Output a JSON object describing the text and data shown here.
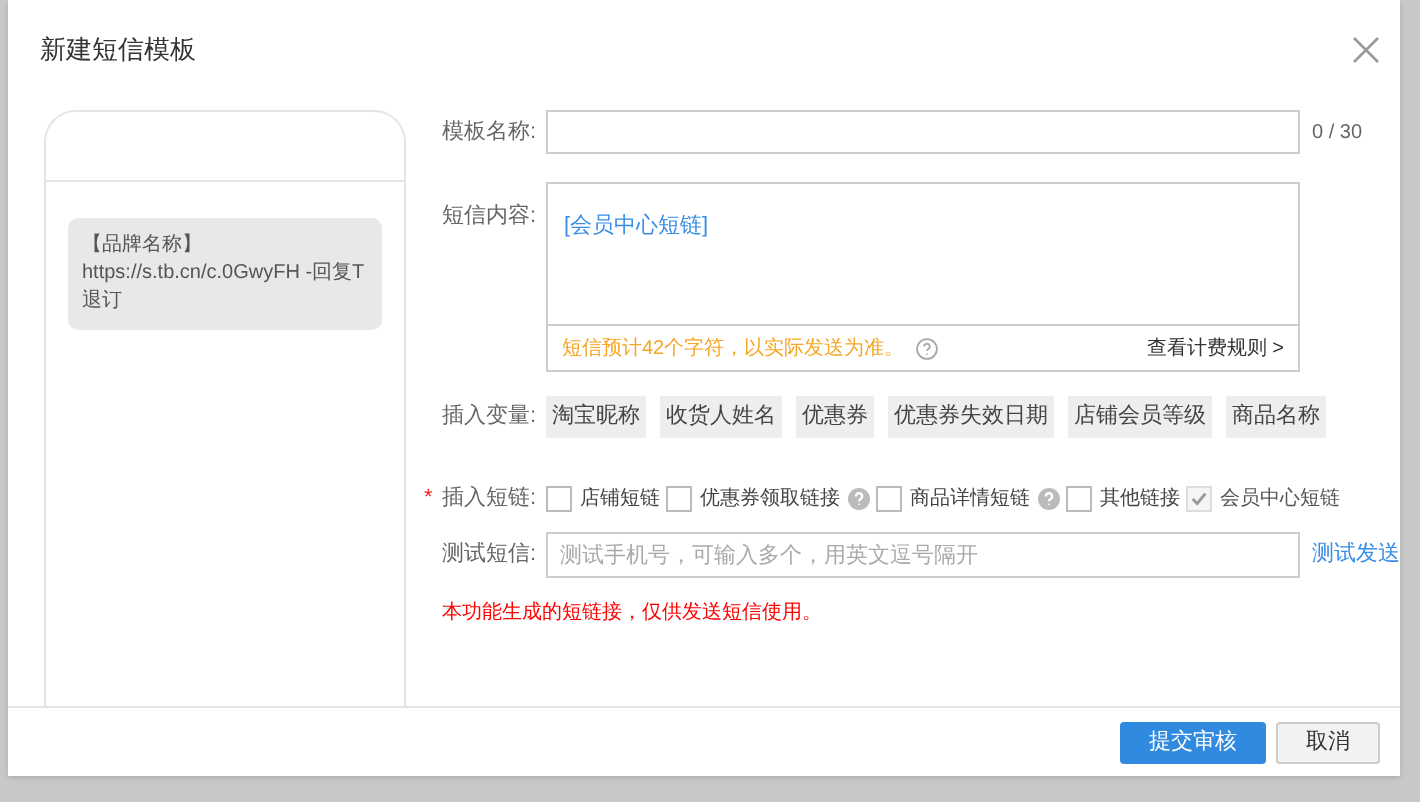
{
  "dialog": {
    "title": "新建短信模板"
  },
  "preview": {
    "lines": [
      "【品牌名称】",
      "https://s.tb.cn/c.0GwyFH -回复T",
      "退订"
    ]
  },
  "template_name": {
    "label": "模板名称:",
    "counter": "0 / 30"
  },
  "content": {
    "label": "短信内容:",
    "value": "[会员中心短链]",
    "estimate": "短信预计42个字符，以实际发送为准。",
    "rules_link": "查看计费规则 >"
  },
  "variables": {
    "label": "插入变量:",
    "items": [
      "淘宝昵称",
      "收货人姓名",
      "优惠券",
      "优惠券失效日期",
      "店铺会员等级",
      "商品名称"
    ]
  },
  "short_links": {
    "label": "插入短链:",
    "required": true,
    "required_mark": "*",
    "items": [
      {
        "label": "店铺短链",
        "checked": false,
        "disabled": false,
        "help": false
      },
      {
        "label": "优惠券领取链接",
        "checked": false,
        "disabled": false,
        "help": true
      },
      {
        "label": "商品详情短链",
        "checked": false,
        "disabled": false,
        "help": true
      },
      {
        "label": "其他链接",
        "checked": false,
        "disabled": false,
        "help": false
      },
      {
        "label": "会员中心短链",
        "checked": true,
        "disabled": true,
        "help": false
      }
    ]
  },
  "test": {
    "label": "测试短信:",
    "placeholder": "测试手机号，可输入多个，用英文逗号隔开",
    "send_link": "测试发送"
  },
  "notice": "本功能生成的短链接，仅供发送短信使用。",
  "buttons": {
    "submit": "提交审核",
    "cancel": "取消"
  }
}
